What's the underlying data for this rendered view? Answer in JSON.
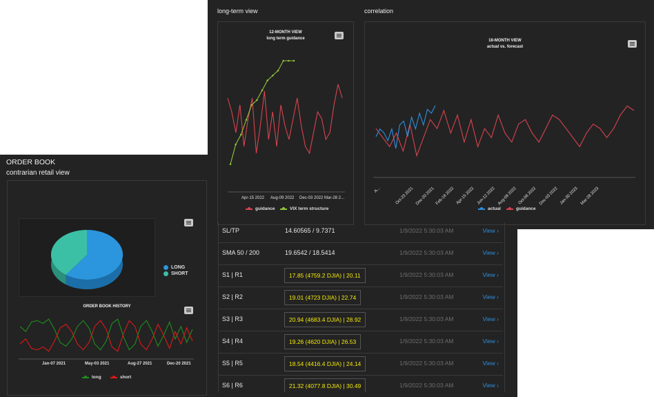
{
  "order_book": {
    "title": "ORDER BOOK",
    "subtitle": "contrarian retail view",
    "pie_legend": [
      "LONG",
      "SHORT"
    ],
    "history_title": "ORDER BOOK HISTORY",
    "history_ticks": [
      "Jan-07 2021",
      "May-03 2021",
      "Aug-27 2021",
      "Dec-20 2021"
    ],
    "history_legend": [
      "long",
      "short"
    ]
  },
  "long_term": {
    "section_title": "long-term view",
    "chart_title_1": "12-MONTH VIEW",
    "chart_title_2": "long term guidance",
    "ticks": [
      "Apr-15 2022",
      "Aug-09 2022",
      "Dec-03 2022",
      "Mar-28 2..."
    ],
    "legend": [
      "guidance",
      "VIX term structure"
    ]
  },
  "correlation": {
    "section_title": "correlation",
    "chart_title_1": "18-MONTH VIEW",
    "chart_title_2": "actual vs. forecast",
    "ticks": [
      "A...",
      "Oct-23 2021",
      "Dec-20 2021",
      "Feb-16 2022",
      "Apr-15 2022",
      "Jun-12 2022",
      "Aug-09 2022",
      "Oct-06 2022",
      "Dec-03 2022",
      "Jan-30 2023",
      "Mar-28 2023"
    ],
    "legend": [
      "actual",
      "guidance"
    ]
  },
  "levels": {
    "rows": [
      {
        "label": "SL/TP",
        "value": "14.60565 / 9.7371",
        "boxed": false,
        "time": "1/9/2022 5:30:03 AM",
        "link": "View ›"
      },
      {
        "label": "SMA 50 / 200",
        "value": "19.6542 / 18.5414",
        "boxed": false,
        "time": "1/9/2022 5:30:03 AM",
        "link": "View ›"
      },
      {
        "label": "S1 | R1",
        "value": "17.85 (4759.2 DJIA) | 20.11",
        "boxed": true,
        "time": "1/9/2022 5:30:03 AM",
        "link": "View ›"
      },
      {
        "label": "S2 | R2",
        "value": "19.01 (4723 DJIA) | 22.74",
        "boxed": true,
        "time": "1/9/2022 5:30:03 AM",
        "link": "View ›"
      },
      {
        "label": "S3 | R3",
        "value": "20.94 (4683.4 DJIA) | 28.92",
        "boxed": true,
        "time": "1/9/2022 5:30:03 AM",
        "link": "View ›"
      },
      {
        "label": "S4 | R4",
        "value": "19.26 (4620 DJIA) | 26.53",
        "boxed": true,
        "time": "1/9/2022 5:30:03 AM",
        "link": "View ›"
      },
      {
        "label": "S5 | R5",
        "value": "18.54 (4416.4 DJIA) | 24.14",
        "boxed": true,
        "time": "1/9/2022 5:30:03 AM",
        "link": "View ›"
      },
      {
        "label": "S6 | R6",
        "value": "21.32 (4077.8 DJIA) | 30.49",
        "boxed": true,
        "time": "1/9/2022 5:30:03 AM",
        "link": "View ›"
      }
    ]
  },
  "colors": {
    "panel_bg": "#232323",
    "guidance": "#d9434f",
    "vix": "#8fc43a",
    "actual": "#2e8fdf",
    "long": "#1f8e1f",
    "short": "#e01818",
    "pie_long": "#2b96dd",
    "pie_short": "#3bc0a6",
    "level_value": "#f5e90a",
    "link": "#2e8fdf"
  },
  "chart_data": [
    {
      "type": "pie",
      "categories": [
        "LONG",
        "SHORT"
      ],
      "values": [
        60,
        40
      ]
    },
    {
      "type": "line",
      "title": "ORDER BOOK HISTORY",
      "series": [
        {
          "name": "long",
          "values": [
            62,
            55,
            68,
            70,
            66,
            72,
            58,
            40,
            35,
            45,
            62,
            70,
            60,
            38,
            30,
            42,
            66,
            72,
            48,
            30,
            38,
            62,
            70,
            55,
            35,
            50,
            68,
            45,
            62,
            40,
            58
          ]
        },
        {
          "name": "short",
          "values": [
            38,
            45,
            32,
            30,
            34,
            28,
            42,
            60,
            65,
            55,
            38,
            30,
            40,
            62,
            70,
            58,
            34,
            28,
            52,
            70,
            62,
            38,
            30,
            45,
            65,
            50,
            32,
            55,
            38,
            60,
            42
          ]
        }
      ]
    },
    {
      "type": "line",
      "title": "12-MONTH VIEW",
      "series": [
        {
          "name": "guidance",
          "values": [
            16,
            14,
            11,
            15,
            9,
            13,
            16,
            8,
            12,
            17,
            10,
            14,
            9,
            15,
            12,
            10,
            13,
            16,
            12,
            9,
            8,
            11,
            14,
            13,
            10,
            11,
            15,
            18,
            16
          ]
        },
        {
          "name": "VIX term structure",
          "values": [
            2,
            6,
            8,
            11,
            14,
            15,
            17,
            19,
            20,
            21,
            23,
            23,
            23
          ]
        }
      ]
    },
    {
      "type": "line",
      "title": "18-MONTH VIEW",
      "series": [
        {
          "name": "actual",
          "values": [
            12,
            14,
            13,
            11,
            14,
            9,
            15,
            16,
            12,
            17,
            14,
            18,
            15,
            19,
            18,
            20
          ]
        },
        {
          "name": "guidance",
          "values": [
            13,
            11,
            9,
            12,
            8,
            14,
            7,
            11,
            15,
            13,
            17,
            12,
            16,
            10,
            15,
            9,
            13,
            11,
            16,
            12,
            10,
            14,
            15,
            12,
            10,
            13,
            16,
            15,
            13,
            11,
            9,
            12,
            14,
            13,
            11,
            13,
            16,
            18,
            17
          ]
        }
      ]
    }
  ]
}
